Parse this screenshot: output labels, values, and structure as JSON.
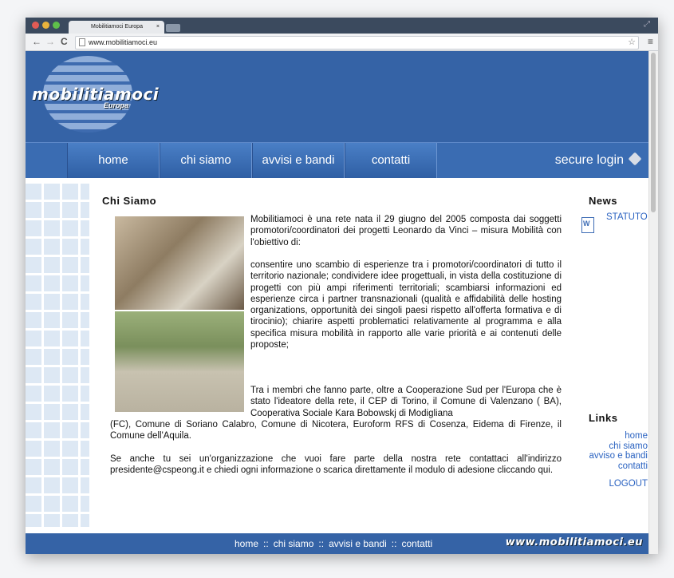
{
  "browser": {
    "tab_title": "Mobilitiamoci Europa",
    "tab_close": "×",
    "url": "www.mobilitiamoci.eu",
    "back": "←",
    "forward": "→",
    "reload": "C",
    "star": "☆",
    "menu": "≡",
    "resize": "⤢",
    "dots": [
      "#e15b55",
      "#e9b33c",
      "#5fbf4a"
    ]
  },
  "logo": {
    "text": "mobilitiamoci",
    "sub": "Europa"
  },
  "nav": {
    "items": [
      "home",
      "chi siamo",
      "avvisi e bandi",
      "contatti"
    ],
    "secure_login": "secure login"
  },
  "main": {
    "title": "Chi Siamo",
    "intro": "Mobilitiamoci è una rete nata il 29 giugno del 2005 composta dai soggetti promotori/coordinatori dei progetti Leonardo da Vinci – misura Mobilità con l'obiettivo di:",
    "goals": "consentire uno scambio di esperienze tra i promotori/coordinatori di tutto il territorio nazionale; condividere idee progettuali, in vista della costituzione di progetti con più ampi riferimenti territoriali; scambiarsi informazioni ed esperienze circa i partner transnazionali (qualità e affidabilità delle hosting organizations, opportunità dei singoli paesi rispetto all'offerta formativa e di tirocinio); chiarire aspetti problematici relativamente al programma e alla specifica misura mobilità in rapporto alle varie priorità e ai contenuti delle proposte;",
    "members_1": "Tra i membri che fanno parte, oltre a Cooperazione Sud per l'Europa che è stato l'ideatore della rete, il CEP di Torino, il Comune di Valenzano ( BA), Cooperativa Sociale Kara Bobowskj di Modigliana",
    "members_2": "(FC), Comune di Soriano Calabro, Comune di Nicotera, Euroform RFS di Cosenza, Eidema di Firenze, il Comune dell'Aquila.",
    "contact": "Se anche tu sei un'organizzazione che vuoi fare parte della nostra rete contattaci all'indirizzo presidente@cspeong.it e chiedi ogni informazione o scarica direttamente il modulo di adesione cliccando qui."
  },
  "sidebar": {
    "news_title": "News",
    "news_item": "STATUTO",
    "links_title": "Links",
    "links": [
      "home",
      "chi siamo",
      "avviso e bandi",
      "contatti"
    ],
    "logout": "LOGOUT"
  },
  "footer": {
    "links": [
      "home",
      "chi siamo",
      "avvisi e bandi",
      "contatti"
    ],
    "separator": "::",
    "url": "www.mobilitiamoci.eu"
  }
}
